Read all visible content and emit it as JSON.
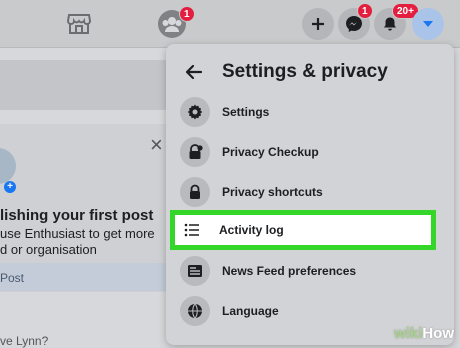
{
  "topbar": {
    "groups_badge": "1",
    "messenger_badge": "1",
    "notifications_badge": "20+",
    "icons": [
      "marketplace-icon",
      "groups-icon",
      "plus-icon",
      "messenger-icon",
      "bell-icon",
      "caret-down-icon"
    ]
  },
  "left": {
    "title": "lishing your first post",
    "line1": "use Enthusiast to get more",
    "line2": "d or organisation",
    "post_button": "Post",
    "bottom_prompt": "ve Lynn?"
  },
  "panel": {
    "title": "Settings & privacy",
    "items": [
      {
        "label": "Settings",
        "icon": "gear-icon"
      },
      {
        "label": "Privacy Checkup",
        "icon": "lock-check-icon"
      },
      {
        "label": "Privacy shortcuts",
        "icon": "lock-icon"
      },
      {
        "label": "Activity log",
        "icon": "list-icon",
        "highlighted": true
      },
      {
        "label": "News Feed preferences",
        "icon": "news-feed-icon"
      },
      {
        "label": "Language",
        "icon": "globe-icon"
      }
    ]
  },
  "watermark": {
    "wiki": "wiki",
    "how": "How"
  },
  "colors": {
    "highlight": "#34d62a",
    "badge": "#e41e3f",
    "accent": "#1877f2"
  }
}
